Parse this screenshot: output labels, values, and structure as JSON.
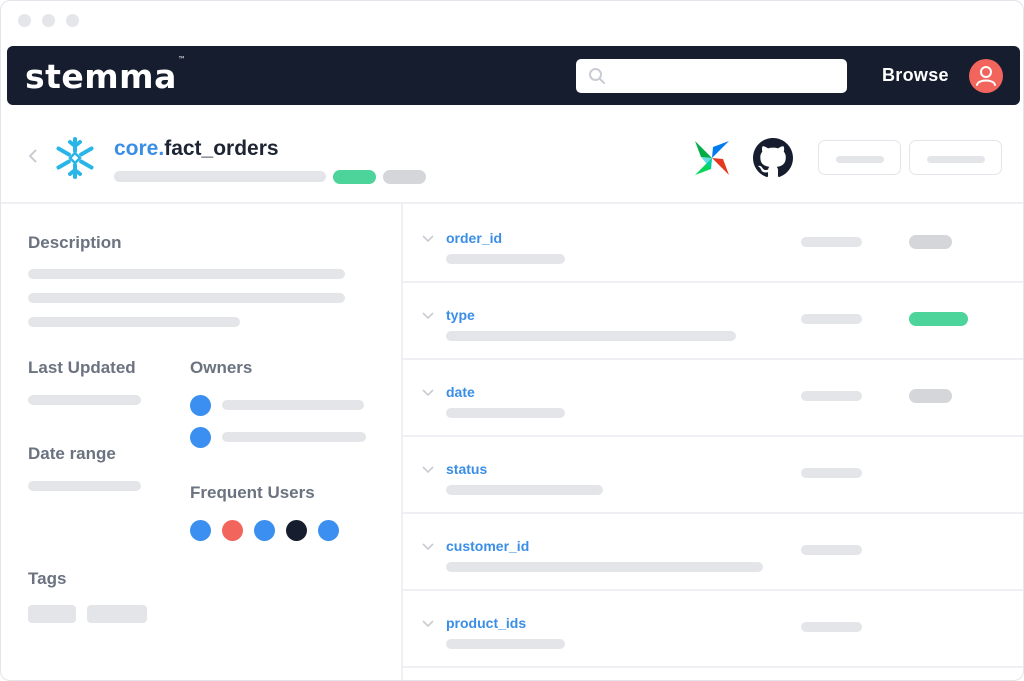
{
  "brand": {
    "logo_text": "stemma",
    "trademark": "™"
  },
  "navbar": {
    "browse_label": "Browse",
    "search_placeholder": ""
  },
  "table": {
    "schema": "core.",
    "name": "fact_orders"
  },
  "sidebar": {
    "description_label": "Description",
    "last_updated_label": "Last Updated",
    "owners_label": "Owners",
    "date_range_label": "Date range",
    "frequent_users_label": "Frequent Users",
    "tags_label": "Tags",
    "owner_avatar_colors": [
      "#3b8ff0",
      "#3b8ff0"
    ],
    "frequent_user_colors": [
      "#3b8ff0",
      "#f2655d",
      "#3b8ff0",
      "#151d2e",
      "#3b8ff0"
    ]
  },
  "columns": [
    {
      "name": "order_id",
      "badge": "grey"
    },
    {
      "name": "type",
      "badge": "green"
    },
    {
      "name": "date",
      "badge": "grey"
    },
    {
      "name": "status",
      "badge": "none"
    },
    {
      "name": "customer_id",
      "badge": "none"
    },
    {
      "name": "product_ids",
      "badge": "none"
    }
  ],
  "colors": {
    "accent": "#3a8ee6",
    "nav_bg": "#151d2e",
    "success": "#4dd49b",
    "avatar": "#f2655d"
  }
}
